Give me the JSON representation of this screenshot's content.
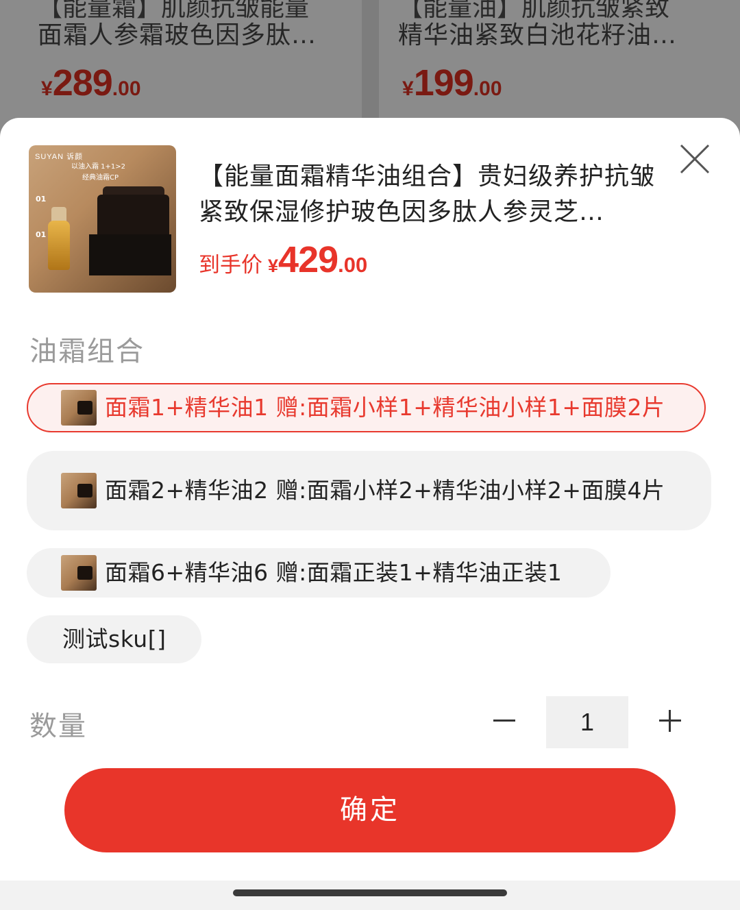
{
  "background": {
    "left_card": {
      "title_partial": "【能量霜】肌颜抗皱能量",
      "title": "面霜人参霜玻色因多肽…",
      "price": {
        "currency": "¥",
        "int": "289",
        "dec": ".00"
      }
    },
    "right_card": {
      "title_partial": "【能量油】肌颜抗皱紧致",
      "title": "精华油紧致白池花籽油…",
      "price": {
        "currency": "¥",
        "int": "199",
        "dec": ".00"
      }
    }
  },
  "product": {
    "image_text": {
      "brand": "SUYAN 诉颜",
      "tag1": "以油入霜 1+1>2",
      "tag2": "经典油霜CP",
      "n1": "01",
      "n2": "01"
    },
    "title": "【能量面霜精华油组合】贵妇级养护抗皱紧致保湿修护玻色因多肽人参灵芝…",
    "price_label": "到手价",
    "price": {
      "currency": "¥",
      "int": "429",
      "dec": ".00"
    }
  },
  "spec": {
    "label": "油霜组合",
    "options": [
      {
        "text": "面霜1+精华油1 赠:面霜小样1+精华油小样1+面膜2片",
        "selected": true
      },
      {
        "text": "面霜2+精华油2 赠:面霜小样2+精华油小样2+面膜4片",
        "selected": false
      },
      {
        "text": "面霜6+精华油6 赠:面霜正装1+精华油正装1",
        "selected": false
      },
      {
        "text": "测试sku[]",
        "selected": false
      }
    ]
  },
  "quantity": {
    "label": "数量",
    "value": "1"
  },
  "confirm_label": "确定",
  "colors": {
    "accent": "#e8352a",
    "selected_bg": "#fdf0ef",
    "option_bg": "#f2f2f2",
    "label_gray": "#9a9a9a"
  },
  "icons": {
    "close": "close-icon",
    "minus": "minus-icon",
    "plus": "plus-icon"
  }
}
